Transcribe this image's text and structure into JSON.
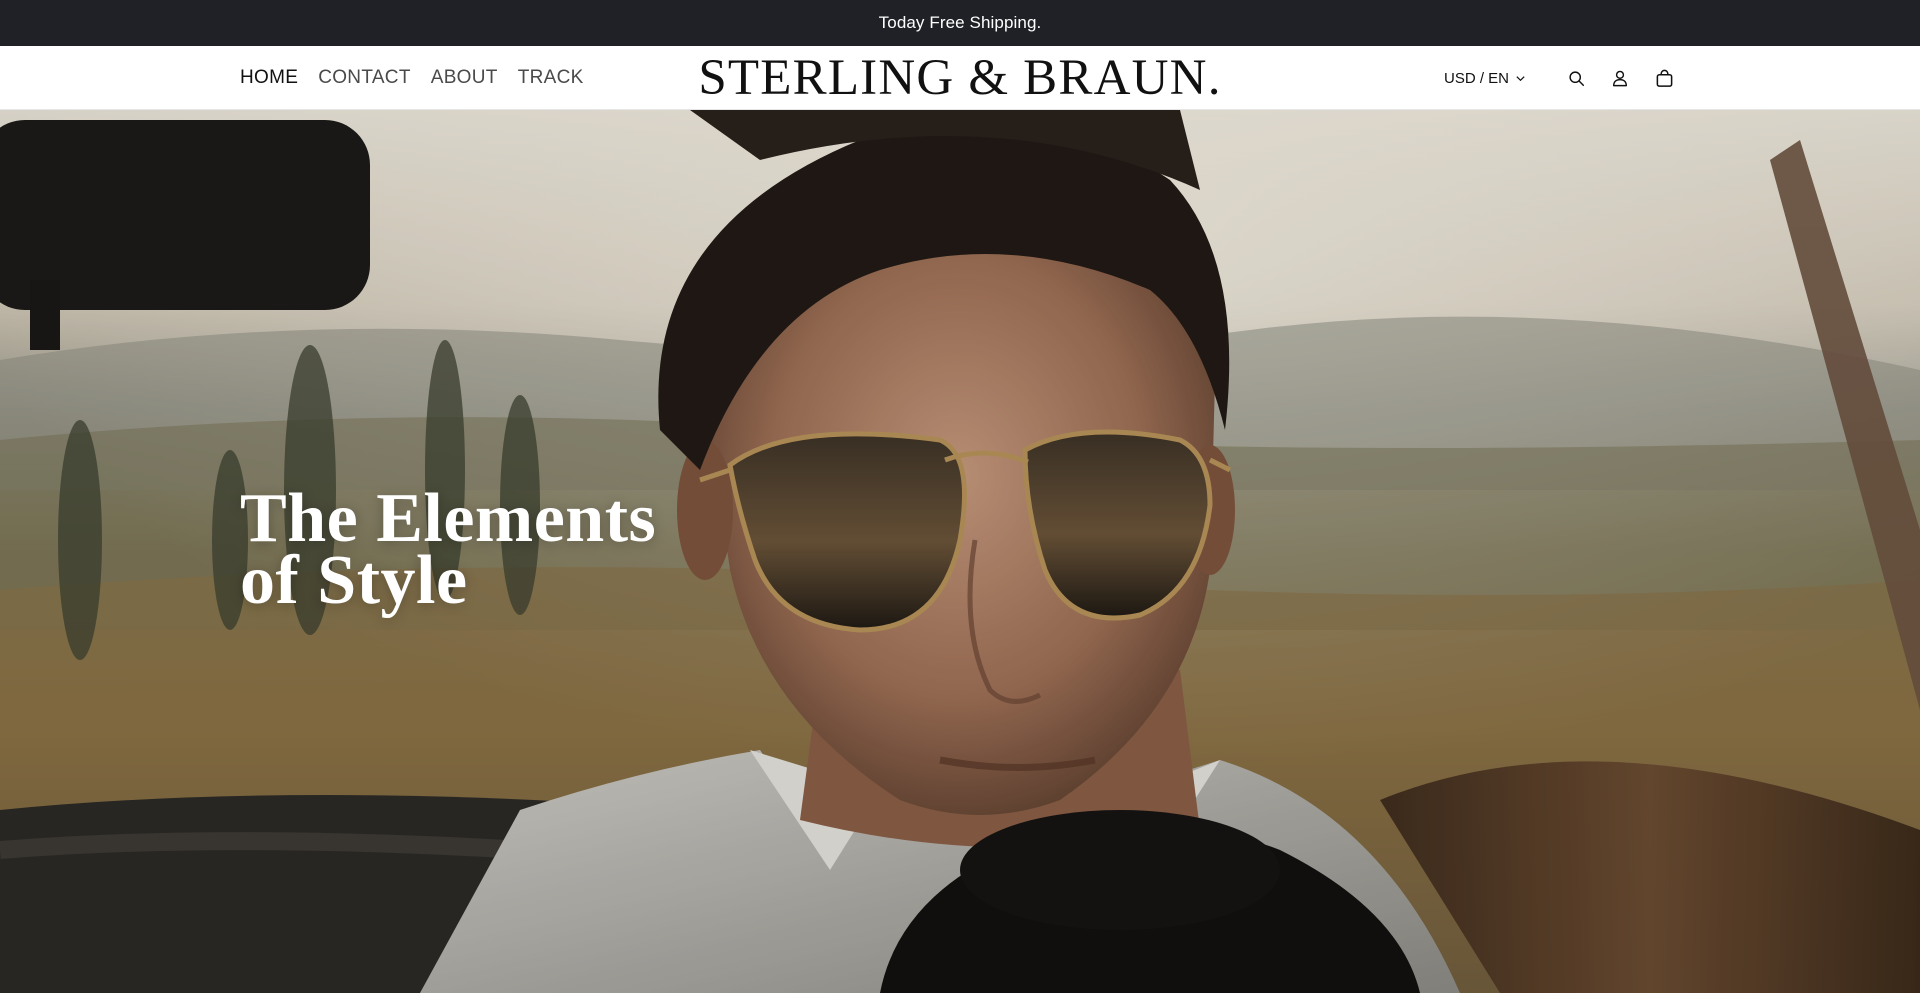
{
  "announcement": {
    "text": "Today Free Shipping."
  },
  "header": {
    "nav": [
      {
        "label": "HOME",
        "active": true
      },
      {
        "label": "CONTACT",
        "active": false
      },
      {
        "label": "ABOUT",
        "active": false
      },
      {
        "label": "TRACK",
        "active": false
      }
    ],
    "logo": "STERLING & BRAUN.",
    "locale": "USD / EN",
    "icons": [
      "search-icon",
      "account-icon",
      "cart-icon",
      "chevron-down-icon"
    ]
  },
  "hero": {
    "title_line1": "The Elements",
    "title_line2": "of Style"
  },
  "colors": {
    "announcement_bg": "#1f2126",
    "header_bg": "#ffffff",
    "text_dark": "#111111",
    "hero_text": "#ffffff"
  }
}
